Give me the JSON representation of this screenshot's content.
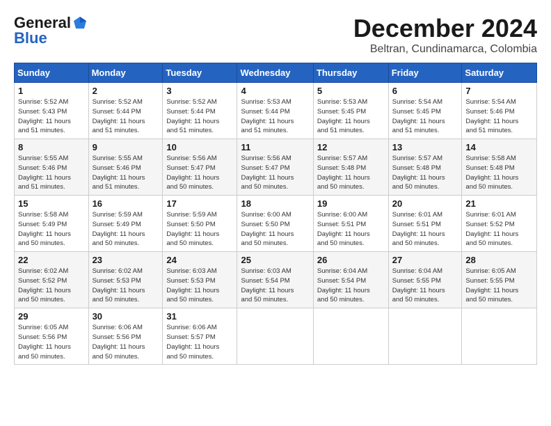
{
  "header": {
    "logo_general": "General",
    "logo_blue": "Blue",
    "month_title": "December 2024",
    "location": "Beltran, Cundinamarca, Colombia"
  },
  "calendar": {
    "days_of_week": [
      "Sunday",
      "Monday",
      "Tuesday",
      "Wednesday",
      "Thursday",
      "Friday",
      "Saturday"
    ],
    "weeks": [
      [
        {
          "day": "1",
          "detail": "Sunrise: 5:52 AM\nSunset: 5:43 PM\nDaylight: 11 hours\nand 51 minutes."
        },
        {
          "day": "2",
          "detail": "Sunrise: 5:52 AM\nSunset: 5:44 PM\nDaylight: 11 hours\nand 51 minutes."
        },
        {
          "day": "3",
          "detail": "Sunrise: 5:52 AM\nSunset: 5:44 PM\nDaylight: 11 hours\nand 51 minutes."
        },
        {
          "day": "4",
          "detail": "Sunrise: 5:53 AM\nSunset: 5:44 PM\nDaylight: 11 hours\nand 51 minutes."
        },
        {
          "day": "5",
          "detail": "Sunrise: 5:53 AM\nSunset: 5:45 PM\nDaylight: 11 hours\nand 51 minutes."
        },
        {
          "day": "6",
          "detail": "Sunrise: 5:54 AM\nSunset: 5:45 PM\nDaylight: 11 hours\nand 51 minutes."
        },
        {
          "day": "7",
          "detail": "Sunrise: 5:54 AM\nSunset: 5:46 PM\nDaylight: 11 hours\nand 51 minutes."
        }
      ],
      [
        {
          "day": "8",
          "detail": "Sunrise: 5:55 AM\nSunset: 5:46 PM\nDaylight: 11 hours\nand 51 minutes."
        },
        {
          "day": "9",
          "detail": "Sunrise: 5:55 AM\nSunset: 5:46 PM\nDaylight: 11 hours\nand 51 minutes."
        },
        {
          "day": "10",
          "detail": "Sunrise: 5:56 AM\nSunset: 5:47 PM\nDaylight: 11 hours\nand 50 minutes."
        },
        {
          "day": "11",
          "detail": "Sunrise: 5:56 AM\nSunset: 5:47 PM\nDaylight: 11 hours\nand 50 minutes."
        },
        {
          "day": "12",
          "detail": "Sunrise: 5:57 AM\nSunset: 5:48 PM\nDaylight: 11 hours\nand 50 minutes."
        },
        {
          "day": "13",
          "detail": "Sunrise: 5:57 AM\nSunset: 5:48 PM\nDaylight: 11 hours\nand 50 minutes."
        },
        {
          "day": "14",
          "detail": "Sunrise: 5:58 AM\nSunset: 5:48 PM\nDaylight: 11 hours\nand 50 minutes."
        }
      ],
      [
        {
          "day": "15",
          "detail": "Sunrise: 5:58 AM\nSunset: 5:49 PM\nDaylight: 11 hours\nand 50 minutes."
        },
        {
          "day": "16",
          "detail": "Sunrise: 5:59 AM\nSunset: 5:49 PM\nDaylight: 11 hours\nand 50 minutes."
        },
        {
          "day": "17",
          "detail": "Sunrise: 5:59 AM\nSunset: 5:50 PM\nDaylight: 11 hours\nand 50 minutes."
        },
        {
          "day": "18",
          "detail": "Sunrise: 6:00 AM\nSunset: 5:50 PM\nDaylight: 11 hours\nand 50 minutes."
        },
        {
          "day": "19",
          "detail": "Sunrise: 6:00 AM\nSunset: 5:51 PM\nDaylight: 11 hours\nand 50 minutes."
        },
        {
          "day": "20",
          "detail": "Sunrise: 6:01 AM\nSunset: 5:51 PM\nDaylight: 11 hours\nand 50 minutes."
        },
        {
          "day": "21",
          "detail": "Sunrise: 6:01 AM\nSunset: 5:52 PM\nDaylight: 11 hours\nand 50 minutes."
        }
      ],
      [
        {
          "day": "22",
          "detail": "Sunrise: 6:02 AM\nSunset: 5:52 PM\nDaylight: 11 hours\nand 50 minutes."
        },
        {
          "day": "23",
          "detail": "Sunrise: 6:02 AM\nSunset: 5:53 PM\nDaylight: 11 hours\nand 50 minutes."
        },
        {
          "day": "24",
          "detail": "Sunrise: 6:03 AM\nSunset: 5:53 PM\nDaylight: 11 hours\nand 50 minutes."
        },
        {
          "day": "25",
          "detail": "Sunrise: 6:03 AM\nSunset: 5:54 PM\nDaylight: 11 hours\nand 50 minutes."
        },
        {
          "day": "26",
          "detail": "Sunrise: 6:04 AM\nSunset: 5:54 PM\nDaylight: 11 hours\nand 50 minutes."
        },
        {
          "day": "27",
          "detail": "Sunrise: 6:04 AM\nSunset: 5:55 PM\nDaylight: 11 hours\nand 50 minutes."
        },
        {
          "day": "28",
          "detail": "Sunrise: 6:05 AM\nSunset: 5:55 PM\nDaylight: 11 hours\nand 50 minutes."
        }
      ],
      [
        {
          "day": "29",
          "detail": "Sunrise: 6:05 AM\nSunset: 5:56 PM\nDaylight: 11 hours\nand 50 minutes."
        },
        {
          "day": "30",
          "detail": "Sunrise: 6:06 AM\nSunset: 5:56 PM\nDaylight: 11 hours\nand 50 minutes."
        },
        {
          "day": "31",
          "detail": "Sunrise: 6:06 AM\nSunset: 5:57 PM\nDaylight: 11 hours\nand 50 minutes."
        },
        {
          "day": "",
          "detail": ""
        },
        {
          "day": "",
          "detail": ""
        },
        {
          "day": "",
          "detail": ""
        },
        {
          "day": "",
          "detail": ""
        }
      ]
    ]
  }
}
